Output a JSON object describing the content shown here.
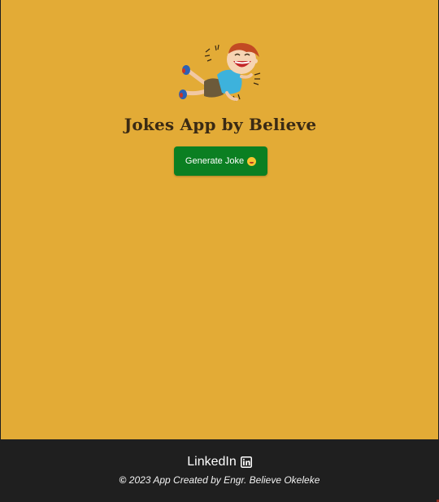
{
  "app": {
    "title": "Jokes App by Believe",
    "illustration": "laughing-boy-illustration"
  },
  "actions": {
    "generate_label": "Generate Joke",
    "generate_icon": "grinning-face-emoji"
  },
  "footer": {
    "linkedin_label": "LinkedIn",
    "linkedin_icon": "linkedin-icon",
    "copyright_symbol": "©",
    "credit_text": " 2023 App Created by Engr. Believe Okeleke"
  },
  "colors": {
    "background": "#e3ab36",
    "button": "#0b7f22",
    "footer": "#1f1f1f",
    "title": "#3a2a14"
  }
}
